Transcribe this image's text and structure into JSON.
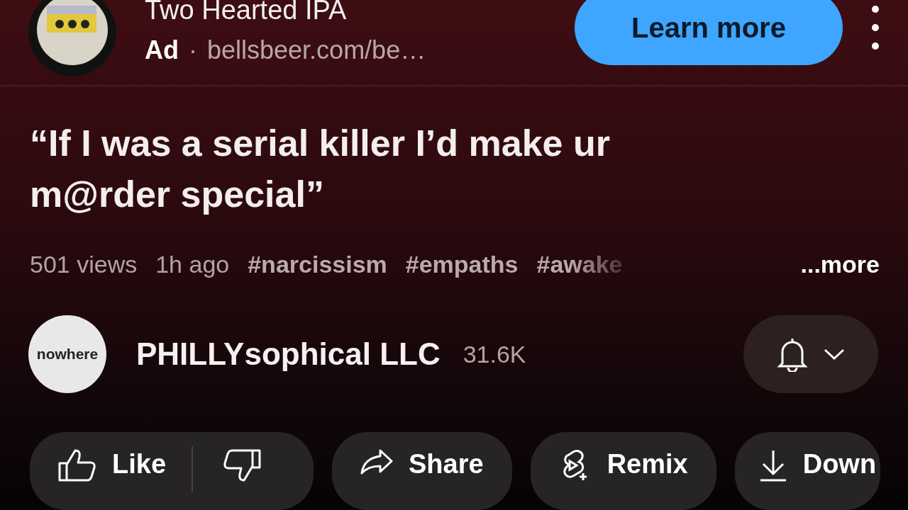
{
  "ad": {
    "title": "Two Hearted IPA",
    "label": "Ad",
    "separator": "·",
    "url": "bellsbeer.com/be…",
    "button": "Learn more"
  },
  "video": {
    "title": "“If I was a serial killer I’d make ur m@rder special”",
    "views": "501 views",
    "age": "1h ago",
    "hashtags": [
      "#narcissism",
      "#empaths",
      "#awake"
    ],
    "more": "...more"
  },
  "channel": {
    "avatar_text": "nowhere",
    "name": "PHILLYsophical LLC",
    "subscribers": "31.6K"
  },
  "actions": [
    {
      "kind": "like",
      "label": "Like"
    },
    {
      "kind": "share",
      "label": "Share"
    },
    {
      "kind": "remix",
      "label": "Remix"
    },
    {
      "kind": "download",
      "label": "Down"
    }
  ]
}
